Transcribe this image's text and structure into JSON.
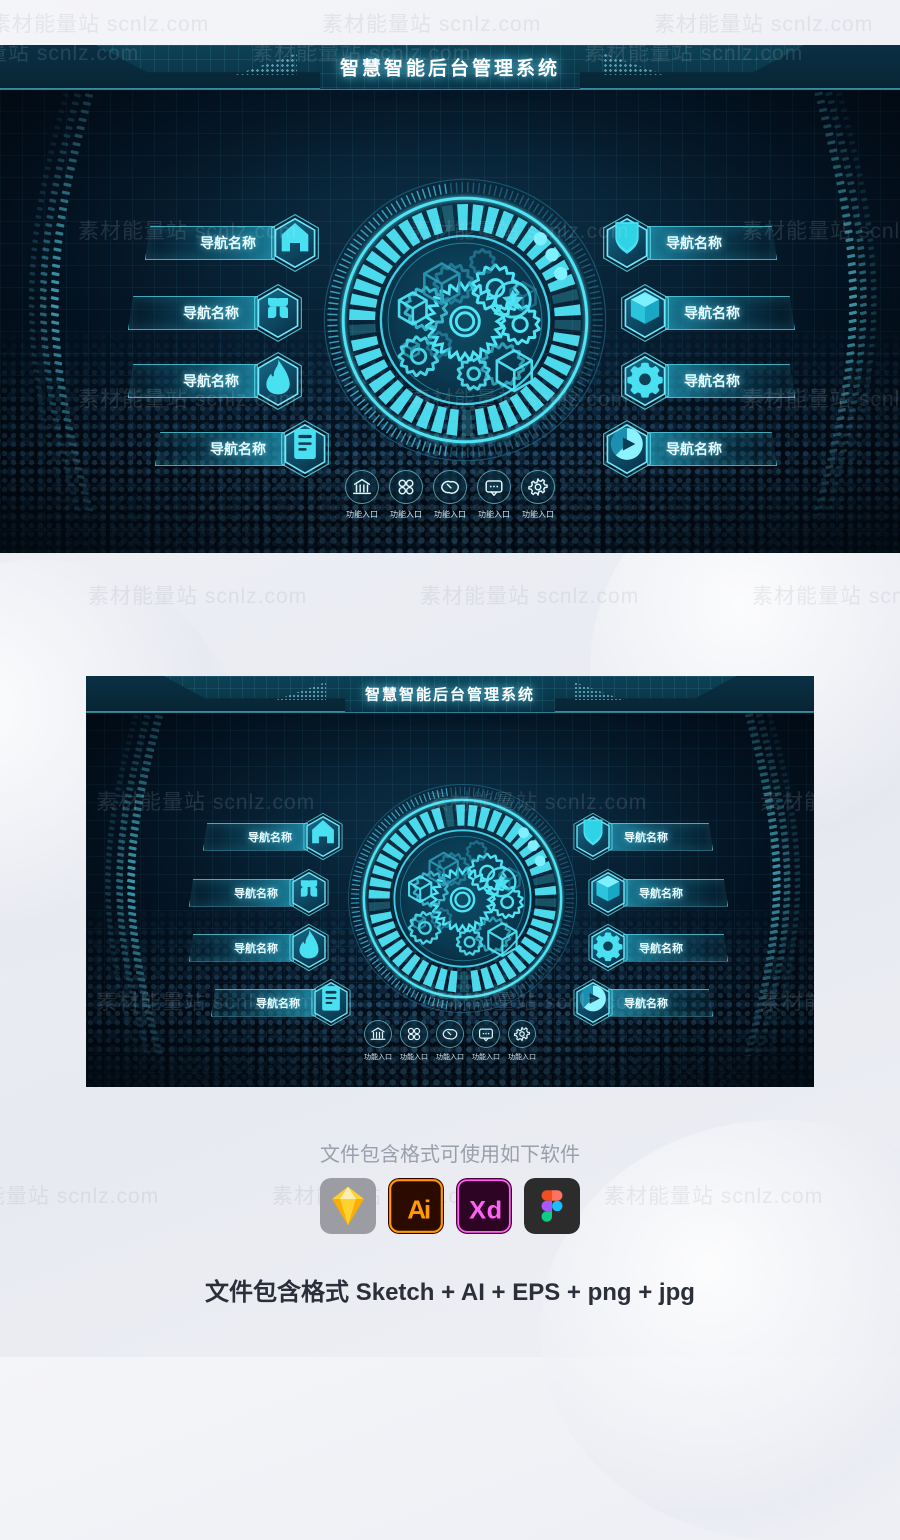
{
  "watermark": {
    "text": "素材能量站 scnlz.com"
  },
  "header": {
    "title": "智慧智能后台管理系统"
  },
  "nav_left": [
    {
      "label": "导航名称",
      "icon": "home-icon"
    },
    {
      "label": "导航名称",
      "icon": "grid-four-dots-icon"
    },
    {
      "label": "导航名称",
      "icon": "flame-icon"
    },
    {
      "label": "导航名称",
      "icon": "document-list-icon"
    }
  ],
  "nav_right": [
    {
      "label": "导航名称",
      "icon": "shield-arrow-down-icon"
    },
    {
      "label": "导航名称",
      "icon": "cube-icon"
    },
    {
      "label": "导航名称",
      "icon": "gear-icon"
    },
    {
      "label": "导航名称",
      "icon": "pie-play-icon"
    }
  ],
  "entries": [
    {
      "label": "功能入口",
      "icon": "bank-icon"
    },
    {
      "label": "功能入口",
      "icon": "apps-grid-icon"
    },
    {
      "label": "功能入口",
      "icon": "handshake-icon"
    },
    {
      "label": "功能入口",
      "icon": "chat-bubble-icon"
    },
    {
      "label": "功能入口",
      "icon": "gear-icon"
    }
  ],
  "hud": {
    "label": "gears-hud",
    "indicator_dots": 3
  },
  "footer": {
    "software_title": "文件包含格式可使用如下软件",
    "formats_note": "文件包含格式 Sketch + AI + EPS + png + jpg",
    "apps": [
      {
        "name": "sketch",
        "label": "Sketch"
      },
      {
        "name": "illustrator",
        "label": "Ai"
      },
      {
        "name": "adobe-xd",
        "label": "Xd"
      },
      {
        "name": "figma",
        "label": "Figma"
      }
    ]
  },
  "colors": {
    "accent_cyan": "#4fe4f5",
    "panel_deep": "#041525",
    "header_blue": "#0c3a4d",
    "light_bg": "#eceef4",
    "footer_text": "#2b2f3a",
    "muted_text": "#9a9fae"
  }
}
